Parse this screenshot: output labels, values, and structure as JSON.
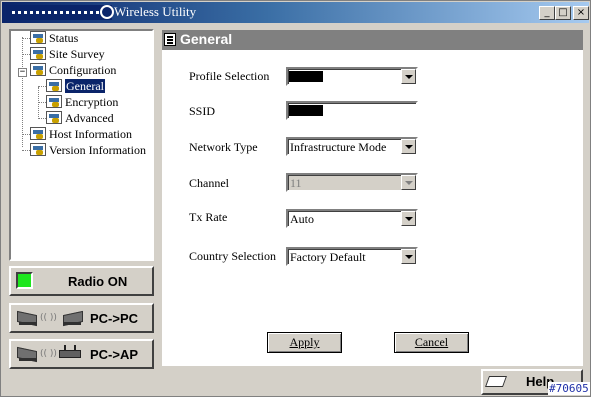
{
  "window": {
    "title": "Wireless Utility",
    "controls": {
      "minimize": "_",
      "maximize": "□",
      "close": "×"
    }
  },
  "tree": {
    "status": "Status",
    "site_survey": "Site Survey",
    "configuration": "Configuration",
    "expander": "−",
    "general": "General",
    "encryption": "Encryption",
    "advanced": "Advanced",
    "host_information": "Host Information",
    "version_information": "Version Information"
  },
  "side_buttons": {
    "radio": "Radio ON",
    "pc_to_pc": "PC->PC",
    "pc_to_ap": "PC->AP",
    "wave_glyph": "((  ))"
  },
  "panel": {
    "title": "General",
    "fields": {
      "profile_selection_label": "Profile Selection",
      "ssid_label": "SSID",
      "network_type_label": "Network Type",
      "network_type_value": "Infrastructure Mode",
      "channel_label": "Channel",
      "channel_value": "11",
      "tx_rate_label": "Tx Rate",
      "tx_rate_value": "Auto",
      "country_selection_label": "Country Selection",
      "country_selection_value": "Factory Default"
    },
    "apply_label": "Apply",
    "cancel_label": "Cancel"
  },
  "help_label": "Help",
  "figure_id": "#70605",
  "colors": {
    "title_bar_start": "#0a246a",
    "title_bar_end": "#a6caf0",
    "radio_led": "#1ee61e",
    "panel_header": "#808080",
    "selection": "#0a246a"
  },
  "icons": {
    "tree_item": "network-config-icon",
    "panel_header": "document-icon",
    "pc": "laptop-icon",
    "ap": "access-point-icon",
    "help": "book-icon"
  }
}
